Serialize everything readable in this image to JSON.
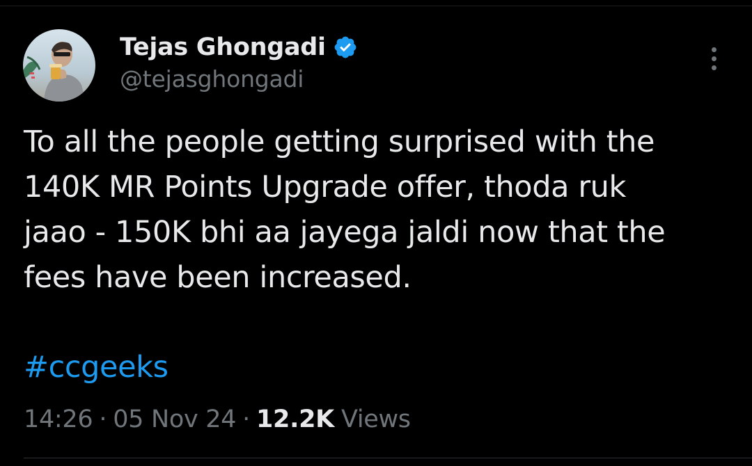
{
  "author": {
    "display_name": "Tejas Ghongadi",
    "handle": "@tejasghongadi",
    "verified": true,
    "verified_color": "#1d9bf0"
  },
  "tweet": {
    "lines": [
      "To all the people getting surprised with the",
      "140K MR Points Upgrade offer, thoda ruk",
      "jaao - 150K bhi aa jayega jaldi now that the",
      "fees have been increased."
    ],
    "hashtag": "#ccgeeks"
  },
  "meta": {
    "time": "14:26",
    "separator": "·",
    "date": "05 Nov 24",
    "views_count": "12.2K",
    "views_label": "Views"
  },
  "colors": {
    "background": "#000000",
    "primary_text": "#e7e9ea",
    "secondary_text": "#71767b",
    "link": "#1d9bf0"
  },
  "icons": {
    "verified": "verified-badge-icon",
    "more": "more-options-icon"
  }
}
